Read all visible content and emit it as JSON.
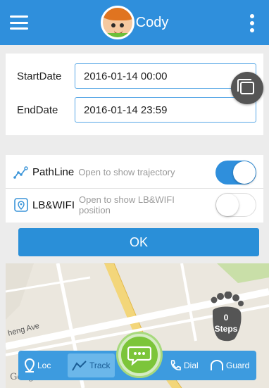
{
  "header": {
    "title": "Cody",
    "menu_icon": "hamburger-menu-icon",
    "more_icon": "vertical-dots-icon"
  },
  "dates": {
    "start_label": "StartDate",
    "start_value": "2016-01-14 00:00",
    "end_label": "EndDate",
    "end_value": "2016-01-14 23:59"
  },
  "options": {
    "pathline": {
      "name": "PathLine",
      "hint": "Open to show trajectory",
      "enabled": true
    },
    "lbwifi": {
      "name": "LB&WIFI",
      "hint": "Open to show LB&WIFI position",
      "enabled": false
    }
  },
  "ok_label": "OK",
  "map": {
    "street": "heng Ave",
    "attribution": "Google",
    "steps_count": "0",
    "steps_label": "Steps"
  },
  "nav": {
    "loc": "Loc",
    "track": "Track",
    "dial": "Dial",
    "guard": "Guard"
  },
  "colors": {
    "header": "#2f8fdc",
    "accent": "#2a8fd8",
    "chat": "#7cc53a"
  }
}
